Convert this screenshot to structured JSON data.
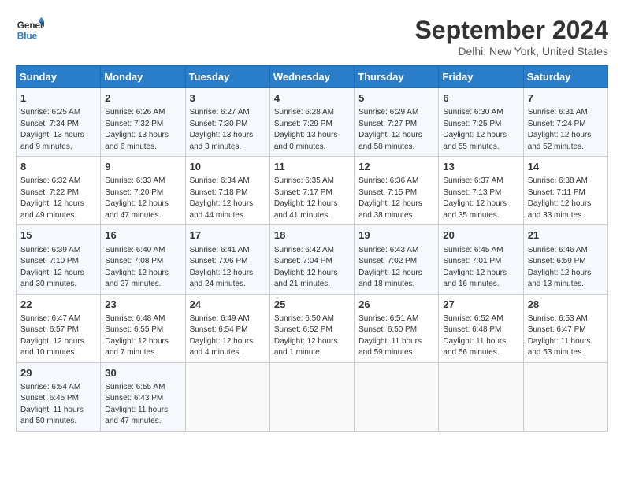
{
  "logo": {
    "line1": "General",
    "line2": "Blue"
  },
  "title": "September 2024",
  "subtitle": "Delhi, New York, United States",
  "headers": [
    "Sunday",
    "Monday",
    "Tuesday",
    "Wednesday",
    "Thursday",
    "Friday",
    "Saturday"
  ],
  "weeks": [
    [
      {
        "day": "1",
        "info": "Sunrise: 6:25 AM\nSunset: 7:34 PM\nDaylight: 13 hours\nand 9 minutes."
      },
      {
        "day": "2",
        "info": "Sunrise: 6:26 AM\nSunset: 7:32 PM\nDaylight: 13 hours\nand 6 minutes."
      },
      {
        "day": "3",
        "info": "Sunrise: 6:27 AM\nSunset: 7:30 PM\nDaylight: 13 hours\nand 3 minutes."
      },
      {
        "day": "4",
        "info": "Sunrise: 6:28 AM\nSunset: 7:29 PM\nDaylight: 13 hours\nand 0 minutes."
      },
      {
        "day": "5",
        "info": "Sunrise: 6:29 AM\nSunset: 7:27 PM\nDaylight: 12 hours\nand 58 minutes."
      },
      {
        "day": "6",
        "info": "Sunrise: 6:30 AM\nSunset: 7:25 PM\nDaylight: 12 hours\nand 55 minutes."
      },
      {
        "day": "7",
        "info": "Sunrise: 6:31 AM\nSunset: 7:24 PM\nDaylight: 12 hours\nand 52 minutes."
      }
    ],
    [
      {
        "day": "8",
        "info": "Sunrise: 6:32 AM\nSunset: 7:22 PM\nDaylight: 12 hours\nand 49 minutes."
      },
      {
        "day": "9",
        "info": "Sunrise: 6:33 AM\nSunset: 7:20 PM\nDaylight: 12 hours\nand 47 minutes."
      },
      {
        "day": "10",
        "info": "Sunrise: 6:34 AM\nSunset: 7:18 PM\nDaylight: 12 hours\nand 44 minutes."
      },
      {
        "day": "11",
        "info": "Sunrise: 6:35 AM\nSunset: 7:17 PM\nDaylight: 12 hours\nand 41 minutes."
      },
      {
        "day": "12",
        "info": "Sunrise: 6:36 AM\nSunset: 7:15 PM\nDaylight: 12 hours\nand 38 minutes."
      },
      {
        "day": "13",
        "info": "Sunrise: 6:37 AM\nSunset: 7:13 PM\nDaylight: 12 hours\nand 35 minutes."
      },
      {
        "day": "14",
        "info": "Sunrise: 6:38 AM\nSunset: 7:11 PM\nDaylight: 12 hours\nand 33 minutes."
      }
    ],
    [
      {
        "day": "15",
        "info": "Sunrise: 6:39 AM\nSunset: 7:10 PM\nDaylight: 12 hours\nand 30 minutes."
      },
      {
        "day": "16",
        "info": "Sunrise: 6:40 AM\nSunset: 7:08 PM\nDaylight: 12 hours\nand 27 minutes."
      },
      {
        "day": "17",
        "info": "Sunrise: 6:41 AM\nSunset: 7:06 PM\nDaylight: 12 hours\nand 24 minutes."
      },
      {
        "day": "18",
        "info": "Sunrise: 6:42 AM\nSunset: 7:04 PM\nDaylight: 12 hours\nand 21 minutes."
      },
      {
        "day": "19",
        "info": "Sunrise: 6:43 AM\nSunset: 7:02 PM\nDaylight: 12 hours\nand 18 minutes."
      },
      {
        "day": "20",
        "info": "Sunrise: 6:45 AM\nSunset: 7:01 PM\nDaylight: 12 hours\nand 16 minutes."
      },
      {
        "day": "21",
        "info": "Sunrise: 6:46 AM\nSunset: 6:59 PM\nDaylight: 12 hours\nand 13 minutes."
      }
    ],
    [
      {
        "day": "22",
        "info": "Sunrise: 6:47 AM\nSunset: 6:57 PM\nDaylight: 12 hours\nand 10 minutes."
      },
      {
        "day": "23",
        "info": "Sunrise: 6:48 AM\nSunset: 6:55 PM\nDaylight: 12 hours\nand 7 minutes."
      },
      {
        "day": "24",
        "info": "Sunrise: 6:49 AM\nSunset: 6:54 PM\nDaylight: 12 hours\nand 4 minutes."
      },
      {
        "day": "25",
        "info": "Sunrise: 6:50 AM\nSunset: 6:52 PM\nDaylight: 12 hours\nand 1 minute."
      },
      {
        "day": "26",
        "info": "Sunrise: 6:51 AM\nSunset: 6:50 PM\nDaylight: 11 hours\nand 59 minutes."
      },
      {
        "day": "27",
        "info": "Sunrise: 6:52 AM\nSunset: 6:48 PM\nDaylight: 11 hours\nand 56 minutes."
      },
      {
        "day": "28",
        "info": "Sunrise: 6:53 AM\nSunset: 6:47 PM\nDaylight: 11 hours\nand 53 minutes."
      }
    ],
    [
      {
        "day": "29",
        "info": "Sunrise: 6:54 AM\nSunset: 6:45 PM\nDaylight: 11 hours\nand 50 minutes."
      },
      {
        "day": "30",
        "info": "Sunrise: 6:55 AM\nSunset: 6:43 PM\nDaylight: 11 hours\nand 47 minutes."
      },
      {
        "day": "",
        "info": ""
      },
      {
        "day": "",
        "info": ""
      },
      {
        "day": "",
        "info": ""
      },
      {
        "day": "",
        "info": ""
      },
      {
        "day": "",
        "info": ""
      }
    ]
  ]
}
